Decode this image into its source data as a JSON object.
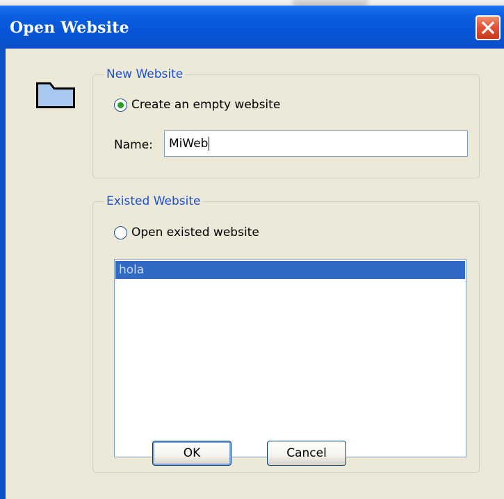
{
  "window": {
    "title": "Open Website"
  },
  "new_website": {
    "legend": "New Website",
    "radio_label": "Create an empty website",
    "radio_selected": true,
    "name_label": "Name:",
    "name_value": "MiWeb"
  },
  "existed_website": {
    "legend": "Existed Website",
    "radio_label": "Open existed website",
    "radio_selected": false,
    "list_items": [
      "hola"
    ]
  },
  "buttons": {
    "ok": "OK",
    "cancel": "Cancel"
  },
  "icons": {
    "folder": "folder-icon",
    "close": "close-icon"
  },
  "colors": {
    "titlebar": "#0a55d6",
    "legend_text": "#1c50d6",
    "selection": "#316ac5",
    "dialog_bg": "#ece9d8",
    "close_button": "#d9442a"
  }
}
